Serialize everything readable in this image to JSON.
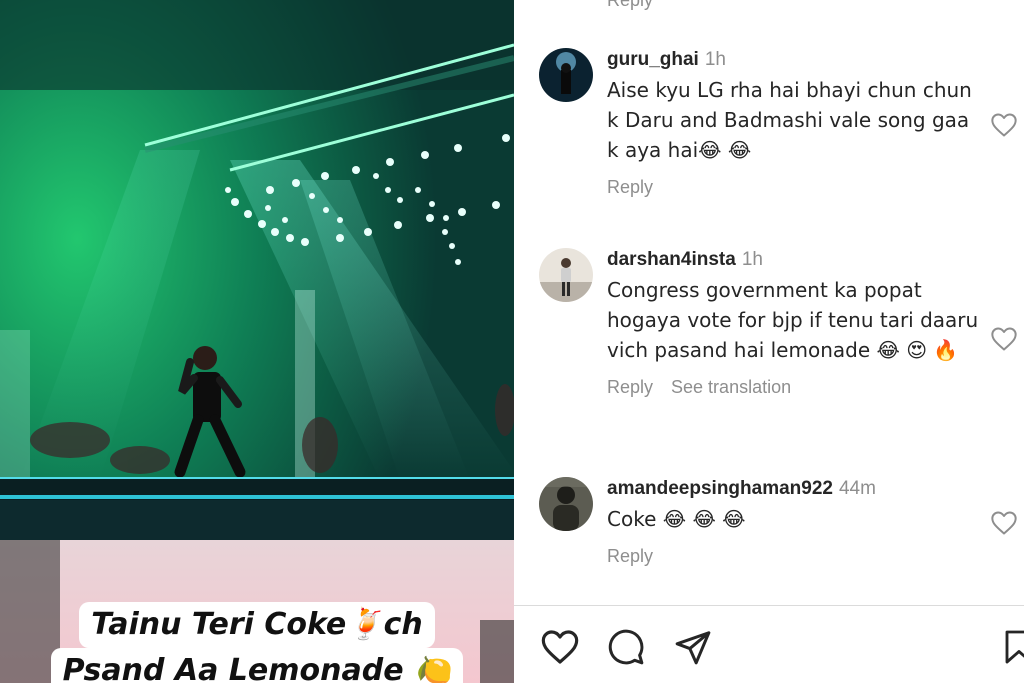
{
  "video": {
    "caption_line1": "Tainu Teri Coke🍹ch",
    "caption_line2": "Psand Aa Lemonade 🍋"
  },
  "comments_panel": {
    "top_reply_label": "Reply",
    "comments": [
      {
        "username": "guru_ghai",
        "time": "1h",
        "text": "Aise kyu LG rha hai bhayi chun chun k Daru and Badmashi vale song gaa k aya hai😂 😂",
        "reply_label": "Reply"
      },
      {
        "username": "darshan4insta",
        "time": "1h",
        "text": "Congress government ka popat hogaya vote for bjp if tenu tari daaru vich pasand hai lemonade 😂 😍 🔥",
        "reply_label": "Reply",
        "translate_label": "See translation"
      },
      {
        "username": "amandeepsinghaman922",
        "time": "44m",
        "text": "Coke 😂 😂 😂",
        "reply_label": "Reply"
      }
    ]
  },
  "action_bar": {
    "icons": [
      "heart-icon",
      "comment-icon",
      "share-icon",
      "bookmark-icon"
    ]
  },
  "colors": {
    "stage_green": "#1fae6a",
    "text_primary": "#262626",
    "text_secondary": "#8e8e8e",
    "divider": "#dbdbdb"
  }
}
